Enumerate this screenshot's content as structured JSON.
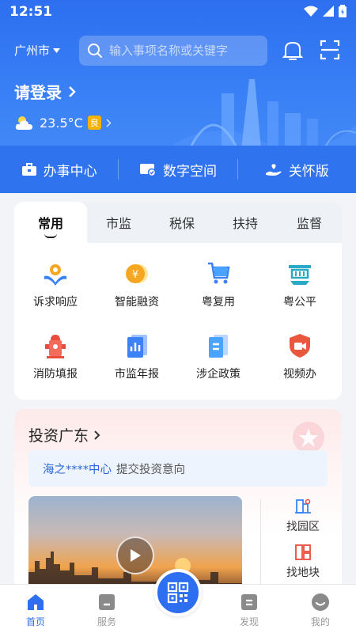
{
  "status_bar": {
    "time": "12:51"
  },
  "header": {
    "city": "广州市",
    "search_placeholder": "输入事项名称或关键字"
  },
  "user": {
    "login_label": "请登录"
  },
  "weather": {
    "temperature": "23.5°C",
    "air_quality": "良"
  },
  "modes": [
    {
      "label": "办事中心",
      "icon": "briefcase-icon"
    },
    {
      "label": "数字空间",
      "icon": "id-card-icon"
    },
    {
      "label": "关怀版",
      "icon": "care-hand-icon"
    }
  ],
  "service_tabs": [
    "常用",
    "市监",
    "税保",
    "扶持",
    "监督"
  ],
  "services": [
    {
      "label": "诉求响应",
      "icon": "appeal-response-icon"
    },
    {
      "label": "智能融资",
      "icon": "finance-coin-icon"
    },
    {
      "label": "粤复用",
      "icon": "cart-reuse-icon"
    },
    {
      "label": "粤公平",
      "icon": "fairness-icon"
    },
    {
      "label": "消防填报",
      "icon": "fire-hydrant-icon"
    },
    {
      "label": "市监年报",
      "icon": "annual-report-icon"
    },
    {
      "label": "涉企政策",
      "icon": "policy-doc-icon"
    },
    {
      "label": "视频办",
      "icon": "video-shield-icon"
    }
  ],
  "invest": {
    "title": "投资广东",
    "notice_highlight": "海之****中心",
    "notice_text": "提交投资意向",
    "links": [
      {
        "label": "找园区",
        "icon": "park-building-icon"
      },
      {
        "label": "找地块",
        "icon": "land-plot-icon"
      }
    ]
  },
  "bottom_nav": [
    {
      "label": "首页",
      "icon": "home-icon"
    },
    {
      "label": "服务",
      "icon": "service-icon"
    },
    {
      "label": "发现",
      "icon": "discover-icon"
    },
    {
      "label": "我的",
      "icon": "profile-icon"
    }
  ],
  "colors": {
    "primary": "#2d6ff0",
    "accent_orange": "#f5a623",
    "accent_red": "#e94b3c"
  }
}
